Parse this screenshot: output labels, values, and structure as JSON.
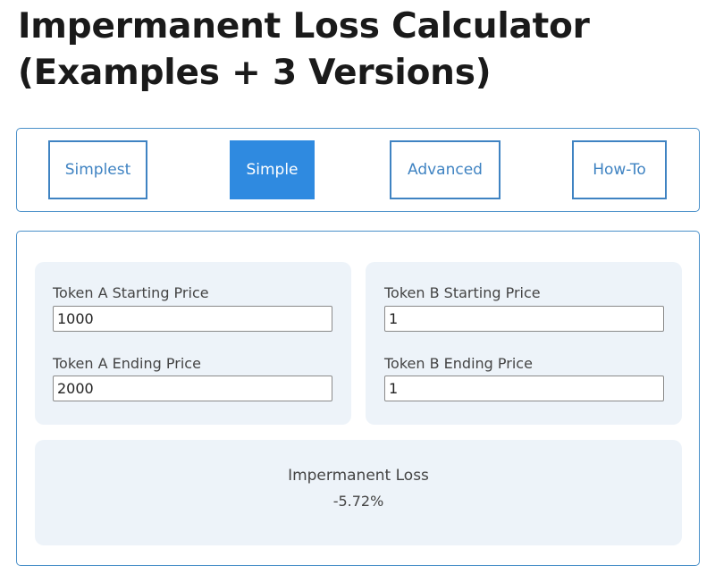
{
  "page": {
    "title_line1": "Impermanent Loss Calculator",
    "title_line2": "(Examples + 3 Versions)"
  },
  "tabs": [
    {
      "label": "Simplest",
      "active": false
    },
    {
      "label": "Simple",
      "active": true
    },
    {
      "label": "Advanced",
      "active": false
    },
    {
      "label": "How-To",
      "active": false
    }
  ],
  "token_a": {
    "start_label": "Token A Starting Price",
    "start_value": "1000",
    "end_label": "Token A Ending Price",
    "end_value": "2000"
  },
  "token_b": {
    "start_label": "Token B Starting Price",
    "start_value": "1",
    "end_label": "Token B Ending Price",
    "end_value": "1"
  },
  "result": {
    "label": "Impermanent Loss",
    "value": "-5.72%"
  },
  "colors": {
    "accent": "#2f8ae0",
    "border": "#4a90c9",
    "card_bg": "#edf3f9"
  }
}
